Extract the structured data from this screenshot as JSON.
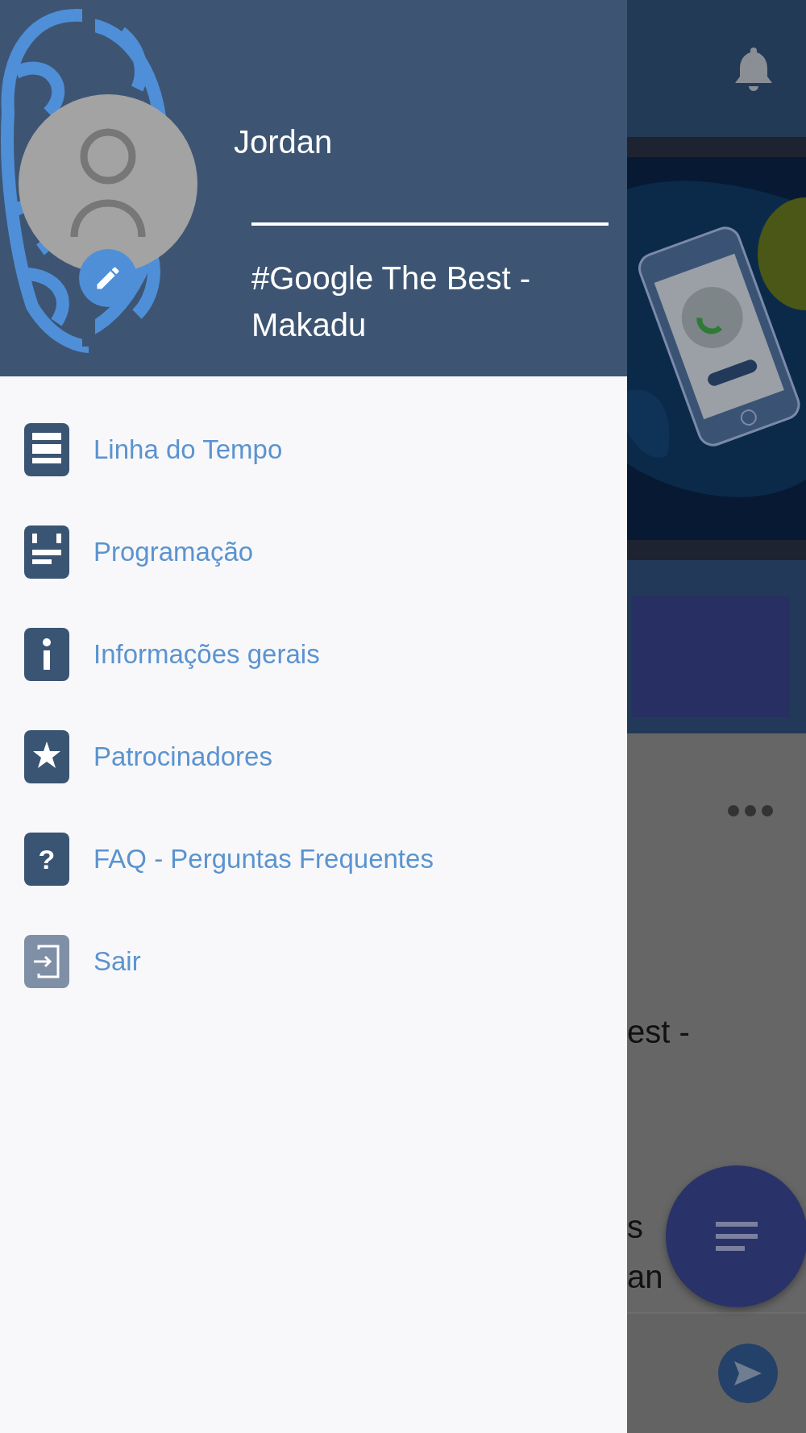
{
  "profile": {
    "name": "Jordan",
    "event": "#Google The Best - Makadu"
  },
  "menu": [
    {
      "label": "Linha do Tempo",
      "kind": "timeline"
    },
    {
      "label": "Programação",
      "kind": "schedule"
    },
    {
      "label": "Informações gerais",
      "kind": "info"
    },
    {
      "label": "Patrocinadores",
      "kind": "sponsors"
    },
    {
      "label": "FAQ - Perguntas Frequentes",
      "kind": "faq",
      "glyph": "?"
    },
    {
      "label": "Sair",
      "kind": "logout"
    }
  ],
  "background": {
    "texts": [
      "est -",
      "s",
      "an"
    ]
  }
}
